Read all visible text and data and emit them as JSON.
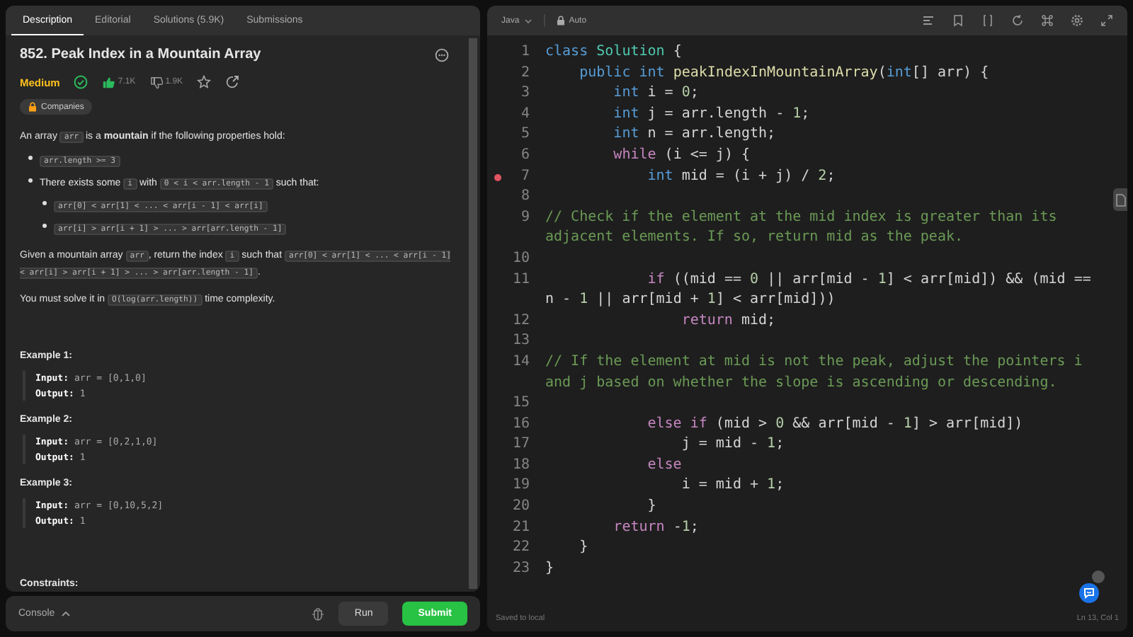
{
  "tabs": [
    {
      "label": "Description",
      "selected": true
    },
    {
      "label": "Editorial",
      "selected": false
    },
    {
      "label": "Solutions (5.9K)",
      "selected": false
    },
    {
      "label": "Submissions",
      "selected": false
    }
  ],
  "problem": {
    "title": "852. Peak Index in a Mountain Array",
    "difficulty": {
      "label": "Medium",
      "kind": "medium"
    },
    "solved": true,
    "likes": "7.1K",
    "dislikes": "1.9K",
    "tag": "Companies",
    "intro": [
      {
        "text": "An array ",
        "kind": "text"
      },
      {
        "text": "arr",
        "kind": "code"
      },
      {
        "text": " is a ",
        "kind": "text"
      },
      {
        "text": "mountain",
        "kind": "bold"
      },
      {
        "text": " if the following properties hold:",
        "kind": "text"
      }
    ],
    "bullets": [
      {
        "segments": [
          {
            "text": "arr.length >= 3",
            "kind": "code"
          }
        ]
      },
      {
        "segments": [
          {
            "text": "There exists some ",
            "kind": "text"
          },
          {
            "text": "i",
            "kind": "code"
          },
          {
            "text": " with ",
            "kind": "text"
          },
          {
            "text": "0 < i < arr.length - 1",
            "kind": "code"
          },
          {
            "text": " such that:",
            "kind": "text"
          }
        ],
        "children": [
          {
            "segments": [
              {
                "text": "arr[0] < arr[1] < ... < arr[i - 1] < arr[i]",
                "kind": "code"
              }
            ]
          },
          {
            "segments": [
              {
                "text": "arr[i] > arr[i + 1] > ... > arr[arr.length - 1]",
                "kind": "code"
              }
            ]
          }
        ]
      }
    ],
    "paragraphs": [
      [
        {
          "text": "Given a mountain array ",
          "kind": "text"
        },
        {
          "text": "arr",
          "kind": "code"
        },
        {
          "text": ", return the index ",
          "kind": "text"
        },
        {
          "text": "i",
          "kind": "code"
        },
        {
          "text": " such that ",
          "kind": "text"
        },
        {
          "text": "arr[0] < arr[1] < ... < arr[i - 1] < arr[i] > arr[i + 1] > ... > arr[arr.length - 1]",
          "kind": "code"
        },
        {
          "text": ".",
          "kind": "text"
        }
      ],
      [
        {
          "text": "You must solve it in ",
          "kind": "text"
        },
        {
          "text": "O(log(arr.length))",
          "kind": "code"
        },
        {
          "text": " time complexity.",
          "kind": "text"
        }
      ]
    ],
    "examples": [
      {
        "title": "Example 1:",
        "input_label": "Input:",
        "input": "arr = [0,1,0]",
        "output_label": "Output:",
        "output": "1"
      },
      {
        "title": "Example 2:",
        "input_label": "Input:",
        "input": "arr = [0,2,1,0]",
        "output_label": "Output:",
        "output": "1"
      },
      {
        "title": "Example 3:",
        "input_label": "Input:",
        "input": "arr = [0,10,5,2]",
        "output_label": "Output:",
        "output": "1"
      }
    ],
    "constraints_title": "Constraints:"
  },
  "console_bar": {
    "console": "Console",
    "run": "Run",
    "submit": "Submit"
  },
  "editor": {
    "language": "Java",
    "mode": "Auto",
    "lines": [
      {
        "number": "1",
        "breakpoint": false,
        "tokens": [
          {
            "text": "class",
            "kind": "kw"
          },
          {
            "text": " Solution",
            "kind": "type"
          },
          {
            "text": " {",
            "kind": "plain"
          }
        ]
      },
      {
        "number": "2",
        "breakpoint": false,
        "tokens": [
          {
            "text": "    public",
            "kind": "kw"
          },
          {
            "text": " int",
            "kind": "kw"
          },
          {
            "text": " peakIndexInMountainArray",
            "kind": "fn"
          },
          {
            "text": "(",
            "kind": "plain"
          },
          {
            "text": "int",
            "kind": "kw"
          },
          {
            "text": "[] arr) {",
            "kind": "plain"
          }
        ]
      },
      {
        "number": "3",
        "breakpoint": false,
        "tokens": [
          {
            "text": "        int",
            "kind": "kw"
          },
          {
            "text": " i = ",
            "kind": "plain"
          },
          {
            "text": "0",
            "kind": "num"
          },
          {
            "text": ";",
            "kind": "plain"
          }
        ]
      },
      {
        "number": "4",
        "breakpoint": false,
        "tokens": [
          {
            "text": "        int",
            "kind": "kw"
          },
          {
            "text": " j = arr.length - ",
            "kind": "plain"
          },
          {
            "text": "1",
            "kind": "num"
          },
          {
            "text": ";",
            "kind": "plain"
          }
        ]
      },
      {
        "number": "5",
        "breakpoint": false,
        "tokens": [
          {
            "text": "        int",
            "kind": "kw"
          },
          {
            "text": " n = arr.length;",
            "kind": "plain"
          }
        ]
      },
      {
        "number": "6",
        "breakpoint": false,
        "tokens": [
          {
            "text": "        while",
            "kind": "ctrl"
          },
          {
            "text": " (i <= j) {",
            "kind": "plain"
          }
        ]
      },
      {
        "number": "7",
        "breakpoint": true,
        "tokens": [
          {
            "text": "            int",
            "kind": "kw"
          },
          {
            "text": " mid = (i + j) / ",
            "kind": "plain"
          },
          {
            "text": "2",
            "kind": "num"
          },
          {
            "text": ";",
            "kind": "plain"
          }
        ]
      },
      {
        "number": "8",
        "breakpoint": false
      },
      {
        "number": "9",
        "breakpoint": false,
        "tokens": [
          {
            "text": "// Check if the element at the mid index is greater than its adjacent elements. If so, return mid as the peak.",
            "kind": "comment"
          }
        ]
      },
      {
        "number": "10",
        "breakpoint": false
      },
      {
        "number": "11",
        "breakpoint": false,
        "tokens": [
          {
            "text": "            if",
            "kind": "ctrl"
          },
          {
            "text": " ((mid == ",
            "kind": "plain"
          },
          {
            "text": "0",
            "kind": "num"
          },
          {
            "text": " || arr[mid - ",
            "kind": "plain"
          },
          {
            "text": "1",
            "kind": "num"
          },
          {
            "text": "] < arr[mid]) && (mid == n - ",
            "kind": "plain"
          },
          {
            "text": "1",
            "kind": "num"
          },
          {
            "text": " || arr[mid + ",
            "kind": "plain"
          },
          {
            "text": "1",
            "kind": "num"
          },
          {
            "text": "] < arr[mid]))",
            "kind": "plain"
          }
        ]
      },
      {
        "number": "12",
        "breakpoint": false,
        "tokens": [
          {
            "text": "                return",
            "kind": "ctrl"
          },
          {
            "text": " mid;",
            "kind": "plain"
          }
        ]
      },
      {
        "number": "13",
        "breakpoint": false
      },
      {
        "number": "14",
        "breakpoint": false,
        "tokens": [
          {
            "text": "// If the element at mid is not the peak, adjust the pointers i and j based on whether the slope is ascending or descending.",
            "kind": "comment"
          }
        ]
      },
      {
        "number": "15",
        "breakpoint": false
      },
      {
        "number": "16",
        "breakpoint": false,
        "tokens": [
          {
            "text": "            else",
            "kind": "ctrl"
          },
          {
            "text": " if",
            "kind": "ctrl"
          },
          {
            "text": " (mid > ",
            "kind": "plain"
          },
          {
            "text": "0",
            "kind": "num"
          },
          {
            "text": " && arr[mid - ",
            "kind": "plain"
          },
          {
            "text": "1",
            "kind": "num"
          },
          {
            "text": "] > arr[mid])",
            "kind": "plain"
          }
        ]
      },
      {
        "number": "17",
        "breakpoint": false,
        "tokens": [
          {
            "text": "                j = mid - ",
            "kind": "plain"
          },
          {
            "text": "1",
            "kind": "num"
          },
          {
            "text": ";",
            "kind": "plain"
          }
        ]
      },
      {
        "number": "18",
        "breakpoint": false,
        "tokens": [
          {
            "text": "            else",
            "kind": "ctrl"
          }
        ]
      },
      {
        "number": "19",
        "breakpoint": false,
        "tokens": [
          {
            "text": "                i = mid + ",
            "kind": "plain"
          },
          {
            "text": "1",
            "kind": "num"
          },
          {
            "text": ";",
            "kind": "plain"
          }
        ]
      },
      {
        "number": "20",
        "breakpoint": false,
        "tokens": [
          {
            "text": "            }",
            "kind": "plain"
          }
        ]
      },
      {
        "number": "21",
        "breakpoint": false,
        "tokens": [
          {
            "text": "        return",
            "kind": "ctrl"
          },
          {
            "text": " -",
            "kind": "plain"
          },
          {
            "text": "1",
            "kind": "num"
          },
          {
            "text": ";",
            "kind": "plain"
          }
        ]
      },
      {
        "number": "22",
        "breakpoint": false,
        "tokens": [
          {
            "text": "    }",
            "kind": "plain"
          }
        ]
      },
      {
        "number": "23",
        "breakpoint": false,
        "tokens": [
          {
            "text": "}",
            "kind": "plain"
          }
        ]
      }
    ],
    "saved": "Saved to local",
    "cursor": "Ln 13, Col 1"
  }
}
